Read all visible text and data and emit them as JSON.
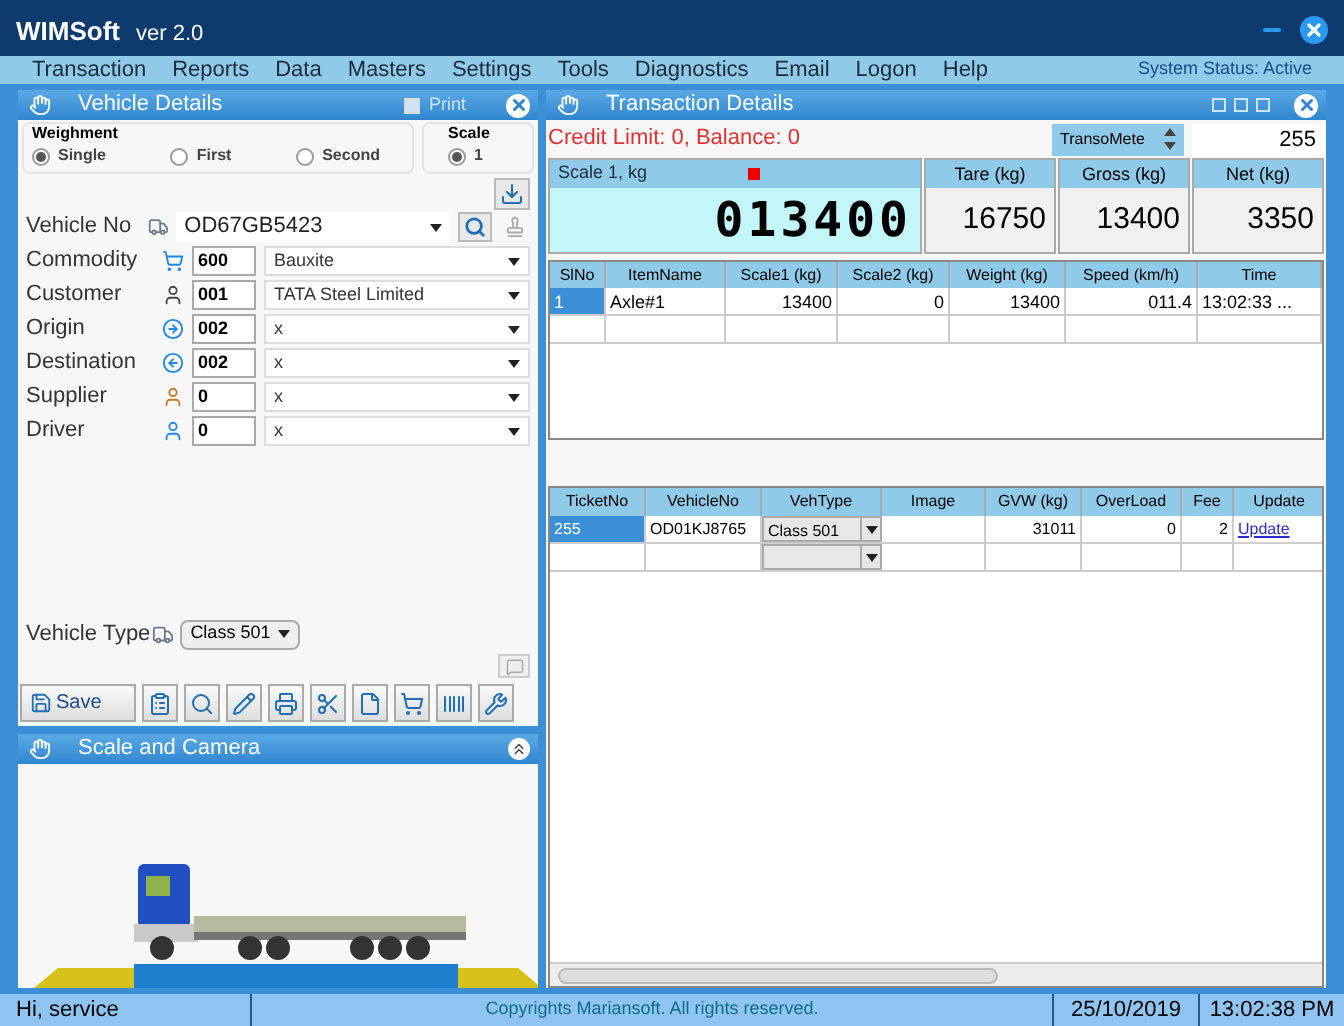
{
  "app": {
    "title": "WIMSoft",
    "version": "ver 2.0"
  },
  "menu": [
    "Transaction",
    "Reports",
    "Data",
    "Masters",
    "Settings",
    "Tools",
    "Diagnostics",
    "Email",
    "Logon",
    "Help"
  ],
  "system_status": "System Status: Active",
  "vehicle_details": {
    "title": "Vehicle Details",
    "print_label": "Print",
    "print_checked": false,
    "weighment": {
      "label": "Weighment",
      "options": [
        {
          "label": "Single",
          "selected": true
        },
        {
          "label": "First",
          "selected": false
        },
        {
          "label": "Second",
          "selected": false
        }
      ]
    },
    "scale": {
      "label": "Scale",
      "options": [
        {
          "label": "1",
          "selected": true
        }
      ]
    },
    "vehicle_no": {
      "label": "Vehicle No",
      "value": "OD67GB5423"
    },
    "fields": [
      {
        "label": "Commodity",
        "code": "600",
        "value": "Bauxite"
      },
      {
        "label": "Customer",
        "code": "001",
        "value": "TATA Steel Limited"
      },
      {
        "label": "Origin",
        "code": "002",
        "value": "x"
      },
      {
        "label": "Destination",
        "code": "002",
        "value": "x"
      },
      {
        "label": "Supplier",
        "code": "0",
        "value": "x"
      },
      {
        "label": "Driver",
        "code": "0",
        "value": "x"
      }
    ],
    "vehicle_type": {
      "label": "Vehicle Type",
      "value": "Class 501"
    },
    "save_label": "Save"
  },
  "scale_camera": {
    "title": "Scale and Camera"
  },
  "transaction": {
    "title": "Transaction Details",
    "credit_text": "Credit Limit: 0, Balance: 0",
    "transometer": "TransoMete",
    "ticket_value": "255",
    "scale_label": "Scale 1, kg",
    "display_value": "013400",
    "readings": [
      {
        "label": "Tare (kg)",
        "value": "16750"
      },
      {
        "label": "Gross (kg)",
        "value": "13400"
      },
      {
        "label": "Net (kg)",
        "value": "3350"
      }
    ],
    "axles": {
      "columns": [
        "SlNo",
        "ItemName",
        "Scale1 (kg)",
        "Scale2 (kg)",
        "Weight (kg)",
        "Speed (km/h)",
        "Time"
      ],
      "rows": [
        {
          "selected": true,
          "cells": [
            "1",
            "Axle#1",
            "13400",
            "0",
            "13400",
            "011.4",
            "13:02:33 ..."
          ]
        }
      ]
    },
    "tickets": {
      "columns": [
        "TicketNo",
        "VehicleNo",
        "VehType",
        "Image",
        "GVW (kg)",
        "OverLoad",
        "Fee",
        "Update"
      ],
      "rows": [
        {
          "selected": true,
          "ticket": "255",
          "vehicle": "OD01KJ8765",
          "type": "Class 501",
          "gvw": "31011",
          "overload": "0",
          "fee": "2",
          "link": "Update"
        }
      ]
    }
  },
  "status_bar": {
    "user": "Hi, service",
    "copyright": "Copyrights Mariansoft. All rights reserved.",
    "date": "25/10/2019",
    "time": "13:02:38 PM"
  }
}
